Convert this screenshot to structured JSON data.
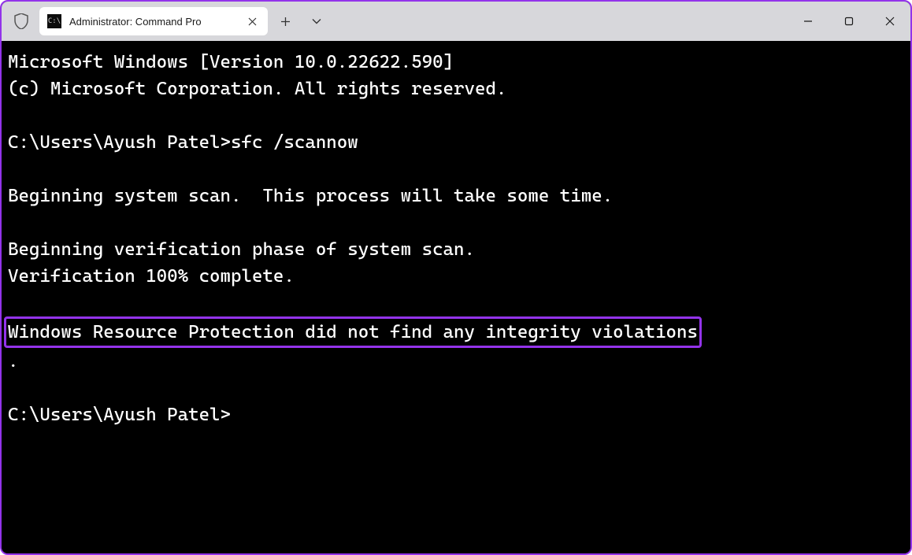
{
  "tab": {
    "title": "Administrator: Command Pro",
    "icon_glyph": "C:\\"
  },
  "terminal": {
    "line1": "Microsoft Windows [Version 10.0.22622.590]",
    "line2": "(c) Microsoft Corporation. All rights reserved.",
    "blank1": "",
    "prompt1_pre": "C:\\Users\\Ayush Patel>",
    "prompt1_cmd": "sfc /scannow",
    "blank2": "",
    "line3": "Beginning system scan.  This process will take some time.",
    "blank3": "",
    "line4": "Beginning verification phase of system scan.",
    "line5": "Verification 100% complete.",
    "blank4": "",
    "highlighted": "Windows Resource Protection did not find any integrity violations",
    "line6": ".",
    "blank5": "",
    "prompt2": "C:\\Users\\Ayush Patel>"
  }
}
